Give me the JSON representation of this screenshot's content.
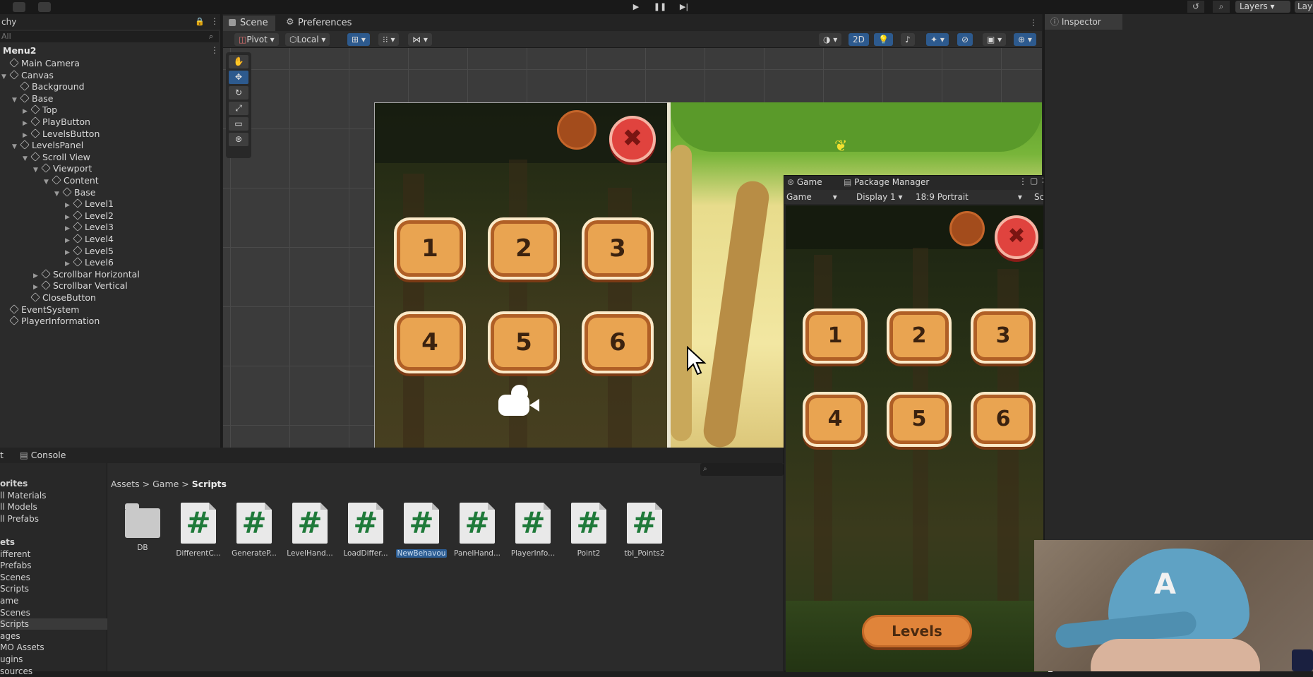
{
  "toolbar": {
    "play_icon": "▶",
    "pause_icon": "❚❚",
    "step_icon": "▶|",
    "history_icon": "↺",
    "search_icon": "⌕",
    "layers_label": "Layers",
    "layout_label_cut": "Lay"
  },
  "hierarchy": {
    "tab_label": "chy",
    "search_placeholder": "All",
    "scene_name": "Menu2",
    "items": [
      {
        "label": "Main Camera",
        "indent": 0,
        "arrow": ""
      },
      {
        "label": "Canvas",
        "indent": 0,
        "arrow": "▼"
      },
      {
        "label": "Background",
        "indent": 1,
        "arrow": ""
      },
      {
        "label": "Base",
        "indent": 1,
        "arrow": "▼"
      },
      {
        "label": "Top",
        "indent": 2,
        "arrow": "▶"
      },
      {
        "label": "PlayButton",
        "indent": 2,
        "arrow": "▶"
      },
      {
        "label": "LevelsButton",
        "indent": 2,
        "arrow": "▶"
      },
      {
        "label": "LevelsPanel",
        "indent": 1,
        "arrow": "▼"
      },
      {
        "label": "Scroll View",
        "indent": 2,
        "arrow": "▼"
      },
      {
        "label": "Viewport",
        "indent": 3,
        "arrow": "▼"
      },
      {
        "label": "Content",
        "indent": 4,
        "arrow": "▼"
      },
      {
        "label": "Base",
        "indent": 5,
        "arrow": "▼"
      },
      {
        "label": "Level1",
        "indent": 6,
        "arrow": "▶"
      },
      {
        "label": "Level2",
        "indent": 6,
        "arrow": "▶"
      },
      {
        "label": "Level3",
        "indent": 6,
        "arrow": "▶"
      },
      {
        "label": "Level4",
        "indent": 6,
        "arrow": "▶"
      },
      {
        "label": "Level5",
        "indent": 6,
        "arrow": "▶"
      },
      {
        "label": "Level6",
        "indent": 6,
        "arrow": "▶"
      },
      {
        "label": "Scrollbar Horizontal",
        "indent": 3,
        "arrow": "▶"
      },
      {
        "label": "Scrollbar Vertical",
        "indent": 3,
        "arrow": "▶"
      },
      {
        "label": "CloseButton",
        "indent": 2,
        "arrow": ""
      },
      {
        "label": "EventSystem",
        "indent": 0,
        "arrow": ""
      },
      {
        "label": "PlayerInformation",
        "indent": 0,
        "arrow": ""
      }
    ]
  },
  "scene": {
    "tab_scene": "Scene",
    "tab_preferences": "Preferences",
    "pivot_label": "Pivot",
    "local_label": "Local",
    "mode_2d": "2D",
    "level_numbers": [
      "1",
      "2",
      "3",
      "4",
      "5",
      "6"
    ],
    "close_glyph": "✖"
  },
  "game": {
    "tab_game": "Game",
    "tab_package_manager": "Package Manager",
    "dropdown_game": "Game",
    "dropdown_display": "Display 1",
    "dropdown_aspect": "18:9 Portrait",
    "scale_label": "Scal",
    "level_numbers": [
      "1",
      "2",
      "3",
      "4",
      "5",
      "6"
    ],
    "levels_button": "Levels"
  },
  "inspector": {
    "tab_label": "Inspector"
  },
  "project": {
    "tab_project": "t",
    "tab_console": "Console",
    "search_placeholder": "",
    "breadcrumb": [
      "Assets",
      "Game",
      "Scripts"
    ],
    "sidebar": [
      {
        "label": "orites",
        "bold": true
      },
      {
        "label": "ll Materials",
        "bold": false
      },
      {
        "label": "ll Models",
        "bold": false
      },
      {
        "label": "ll Prefabs",
        "bold": false
      },
      {
        "label": "",
        "bold": false
      },
      {
        "label": "ets",
        "bold": true
      },
      {
        "label": "ifferent",
        "bold": false
      },
      {
        "label": "Prefabs",
        "bold": false
      },
      {
        "label": "Scenes",
        "bold": false
      },
      {
        "label": "Scripts",
        "bold": false
      },
      {
        "label": "ame",
        "bold": false
      },
      {
        "label": "Scenes",
        "bold": false
      },
      {
        "label": "Scripts",
        "bold": false,
        "selected": true
      },
      {
        "label": "ages",
        "bold": false
      },
      {
        "label": "MO Assets",
        "bold": false
      },
      {
        "label": "ugins",
        "bold": false
      },
      {
        "label": "sources",
        "bold": false
      }
    ],
    "files": [
      {
        "label": "DB",
        "type": "folder"
      },
      {
        "label": "DifferentC...",
        "type": "script"
      },
      {
        "label": "GenerateP...",
        "type": "script"
      },
      {
        "label": "LevelHand...",
        "type": "script"
      },
      {
        "label": "LoadDiffer...",
        "type": "script"
      },
      {
        "label": "NewBehavou",
        "type": "script",
        "selected": true
      },
      {
        "label": "PanelHand...",
        "type": "script"
      },
      {
        "label": "PlayerInfo...",
        "type": "script"
      },
      {
        "label": "Point2",
        "type": "script"
      },
      {
        "label": "tbl_Points2",
        "type": "script"
      }
    ]
  },
  "webcam": {
    "cap_letter": "A"
  }
}
